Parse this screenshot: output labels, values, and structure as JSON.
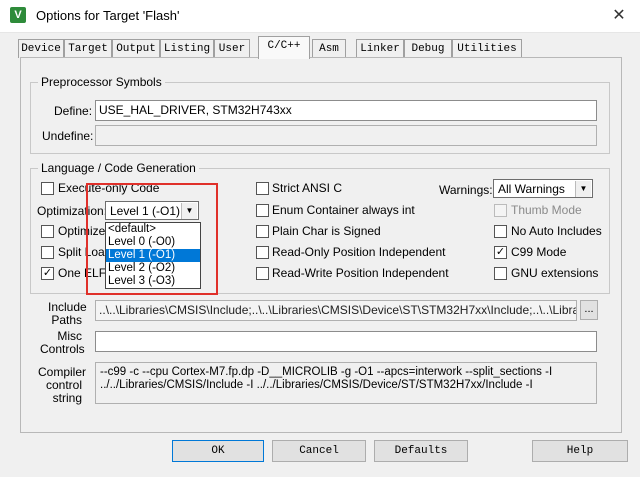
{
  "window": {
    "title": "Options for Target 'Flash'",
    "icon": "keil-uvision-icon",
    "close_glyph": "✕"
  },
  "tabs": [
    {
      "label": "Device",
      "active": false
    },
    {
      "label": "Target",
      "active": false
    },
    {
      "label": "Output",
      "active": false
    },
    {
      "label": "Listing",
      "active": false
    },
    {
      "label": "User",
      "active": false
    },
    {
      "label": "C/C++",
      "active": true
    },
    {
      "label": "Asm",
      "active": false
    },
    {
      "label": "Linker",
      "active": false
    },
    {
      "label": "Debug",
      "active": false
    },
    {
      "label": "Utilities",
      "active": false
    }
  ],
  "preprocessor": {
    "group_label": "Preprocessor Symbols",
    "define_label": "Define:",
    "define_value": "USE_HAL_DRIVER, STM32H743xx",
    "undefine_label": "Undefine:",
    "undefine_value": ""
  },
  "language": {
    "group_label": "Language / Code Generation",
    "execute_only": {
      "label": "Execute-only Code",
      "checked": false
    },
    "optimization": {
      "label": "Optimization:",
      "selected": "Level 1 (-O1)",
      "options": [
        "<default>",
        "Level 0 (-O0)",
        "Level 1 (-O1)",
        "Level 2 (-O2)",
        "Level 3 (-O3)"
      ],
      "selected_index": 2
    },
    "optimize_for_time": {
      "label": "Optimize f",
      "checked": false
    },
    "split_load": {
      "label": "Split Load",
      "checked": false
    },
    "one_elf": {
      "label": "One ELF",
      "checked": true
    },
    "strict_ansi": {
      "label": "Strict ANSI C",
      "checked": false
    },
    "enum_container": {
      "label": "Enum Container always int",
      "checked": false
    },
    "plain_char": {
      "label": "Plain Char is Signed",
      "checked": false
    },
    "ropi": {
      "label": "Read-Only Position Independent",
      "checked": false
    },
    "rwpi": {
      "label": "Read-Write Position Independent",
      "checked": false
    },
    "warnings": {
      "label": "Warnings:",
      "selected": "All Warnings"
    },
    "thumb_mode": {
      "label": "Thumb Mode",
      "checked": false,
      "disabled": true
    },
    "no_auto_includes": {
      "label": "No Auto Includes",
      "checked": false
    },
    "c99_mode": {
      "label": "C99 Mode",
      "checked": true
    },
    "gnu_extensions": {
      "label": "GNU extensions",
      "checked": false
    }
  },
  "include_paths": {
    "label_line1": "Include",
    "label_line2": "Paths",
    "value": "..\\..\\Libraries\\CMSIS\\Include;..\\..\\Libraries\\CMSIS\\Device\\ST\\STM32H7xx\\Include;..\\..\\Libraries\\S",
    "browse_label": "..."
  },
  "misc_controls": {
    "label_line1": "Misc",
    "label_line2": "Controls",
    "value": ""
  },
  "compiler_control": {
    "label_line1": "Compiler",
    "label_line2": "control",
    "label_line3": "string",
    "line1": "--c99 -c --cpu Cortex-M7.fp.dp -D__MICROLIB -g -O1 --apcs=interwork --split_sections -I",
    "line2": "../../Libraries/CMSIS/Include -I ../../Libraries/CMSIS/Device/ST/STM32H7xx/Include -I"
  },
  "buttons": {
    "ok": "OK",
    "cancel": "Cancel",
    "defaults": "Defaults",
    "help": "Help"
  },
  "annotation": {
    "highlight_color": "#e0302a"
  }
}
